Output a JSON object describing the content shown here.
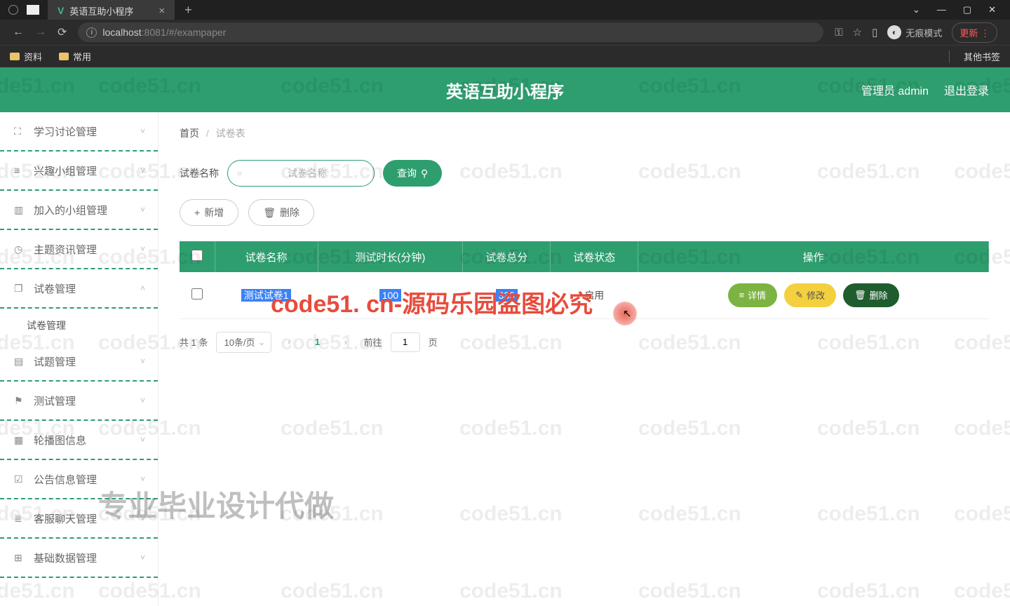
{
  "browser": {
    "tab_title": "英语互助小程序",
    "url_host": "localhost",
    "url_rest": ":8081/#/exampaper",
    "incognito": "无痕模式",
    "update": "更新",
    "bookmarks": [
      "资料",
      "常用"
    ],
    "other_bookmarks": "其他书签"
  },
  "header": {
    "title": "英语互助小程序",
    "admin": "管理员 admin",
    "logout": "退出登录"
  },
  "sidebar": {
    "items": [
      {
        "icon": "⛶",
        "label": "学习讨论管理",
        "open": false
      },
      {
        "icon": "≡",
        "label": "兴趣小组管理",
        "open": false
      },
      {
        "icon": "▥",
        "label": "加入的小组管理",
        "open": false
      },
      {
        "icon": "◷",
        "label": "主题资讯管理",
        "open": false
      },
      {
        "icon": "❐",
        "label": "试卷管理",
        "open": true,
        "children": [
          "试卷管理"
        ]
      },
      {
        "icon": "▤",
        "label": "试题管理",
        "open": false
      },
      {
        "icon": "⚑",
        "label": "测试管理",
        "open": false
      },
      {
        "icon": "▦",
        "label": "轮播图信息",
        "open": false
      },
      {
        "icon": "☑",
        "label": "公告信息管理",
        "open": false
      },
      {
        "icon": "≣",
        "label": "客服聊天管理",
        "open": false
      },
      {
        "icon": "⊞",
        "label": "基础数据管理",
        "open": false
      }
    ]
  },
  "breadcrumb": {
    "home": "首页",
    "current": "试卷表"
  },
  "filter": {
    "label": "试卷名称",
    "placeholder": "试卷名称",
    "search": "查询"
  },
  "toolbar": {
    "add": "新增",
    "delete": "删除"
  },
  "table": {
    "headers": [
      "",
      "试卷名称",
      "测试时长(分钟)",
      "试卷总分",
      "试卷状态",
      "操作"
    ],
    "rows": [
      {
        "name": "测试试卷1",
        "duration": "100",
        "total": "335",
        "status": "启用"
      }
    ],
    "actions": {
      "detail": "详情",
      "edit": "修改",
      "delete": "删除"
    }
  },
  "pagination": {
    "total": "共 1 条",
    "page_size": "10条/页",
    "current": "1",
    "goto": "前往",
    "page_input": "1",
    "page_suffix": "页"
  },
  "watermark": {
    "repeat": "code51.cn",
    "banner": "code51. cn-源码乐园盗图必究",
    "ad": "专业毕业设计代做"
  }
}
